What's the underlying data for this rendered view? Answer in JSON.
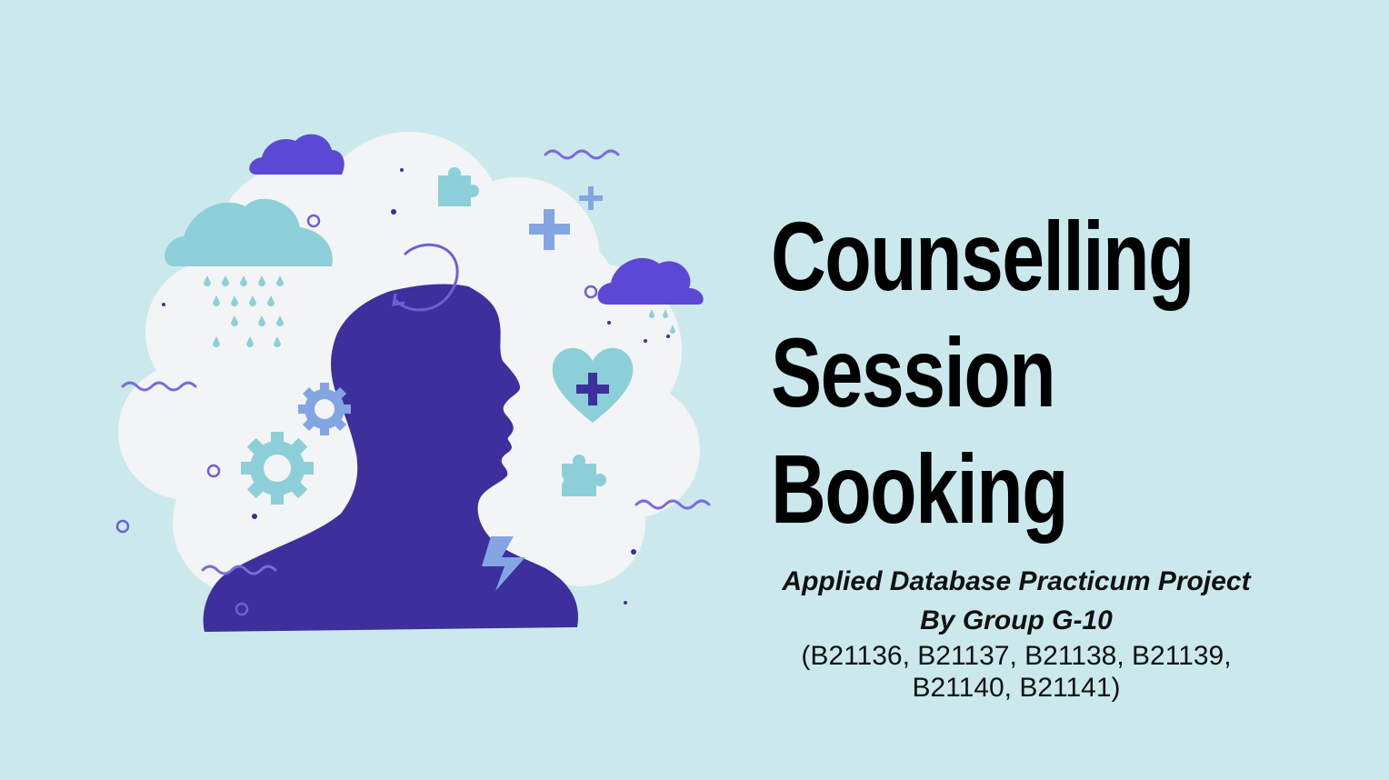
{
  "title": {
    "lines": [
      "Counselling",
      "Session",
      "Booking"
    ]
  },
  "subtitle": {
    "project": "Applied Database Practicum Project",
    "group": "By Group G-10",
    "members": "(B21136, B21137, B21138, B21139, B21140, B21141)"
  },
  "illustration": {
    "icons": [
      "head-silhouette-icon",
      "cloud-icon",
      "rain-cloud-icon",
      "gear-icon",
      "heart-plus-icon",
      "puzzle-icon",
      "lightning-icon",
      "plus-icon",
      "refresh-arrow-icon"
    ]
  },
  "colors": {
    "background": "#cbe9ec",
    "indigo": "#3d2f9c",
    "violet": "#5b48d4",
    "teal": "#8ccfd8",
    "blue": "#83a6e3",
    "cloud_white": "#f3f4f5"
  }
}
